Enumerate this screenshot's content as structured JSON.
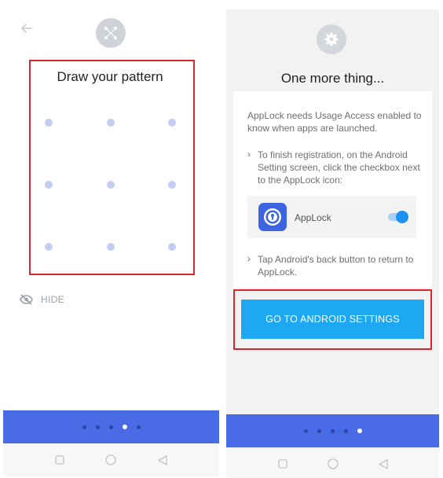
{
  "left": {
    "pattern_title": "Draw your pattern",
    "hide_label": "HIDE",
    "page_dots": [
      false,
      false,
      false,
      true,
      false
    ]
  },
  "right": {
    "title": "One more thing...",
    "intro": "AppLock needs Usage Access enabled to know when apps are launched.",
    "step1": "To finish registration, on the Android Setting screen, click the checkbox next to the AppLock icon:",
    "app_name": "AppLock",
    "step2": "Tap Android's back button to return to AppLock.",
    "cta_label": "GO TO ANDROID SETTINGS",
    "page_dots": [
      false,
      false,
      false,
      false,
      true
    ]
  },
  "colors": {
    "accent_blue": "#4a6be6",
    "cta_blue": "#1ea7f3",
    "highlight_red": "#d9262e",
    "pattern_dot": "#c3cdf2"
  },
  "icons": [
    "back-arrow-icon",
    "pattern-icon",
    "eye-off-icon",
    "gear-icon",
    "applock-icon",
    "square-nav-icon",
    "circle-nav-icon",
    "triangle-nav-icon"
  ]
}
